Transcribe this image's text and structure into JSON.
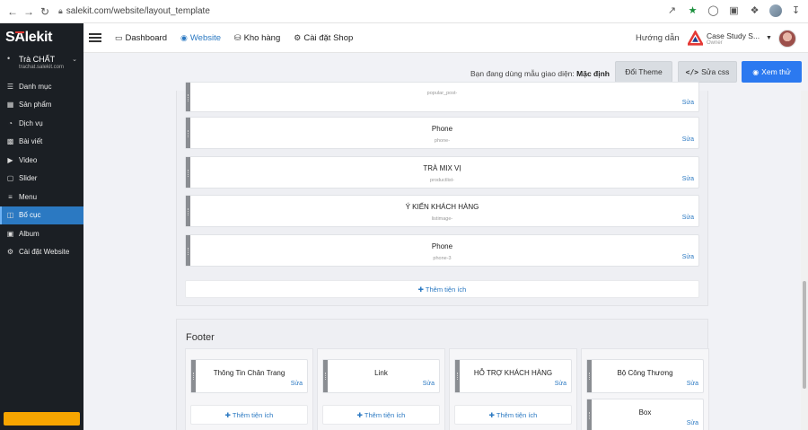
{
  "browser": {
    "url": "salekit.com/website/layout_template"
  },
  "sidebar": {
    "logo": "SAlekit",
    "logo_pre": "S",
    "logo_a": "A",
    "logo_post": "lekit",
    "store_name": "Trà CHẤT",
    "store_domain": "trachat.salekit.com",
    "items": [
      {
        "label": "Danh mục",
        "icon": "list-icon"
      },
      {
        "label": "Sản phẩm",
        "icon": "box-icon"
      },
      {
        "label": "Dịch vụ",
        "icon": "service-icon"
      },
      {
        "label": "Bài viết",
        "icon": "article-icon"
      },
      {
        "label": "Video",
        "icon": "video-icon"
      },
      {
        "label": "Slider",
        "icon": "slider-icon"
      },
      {
        "label": "Menu",
        "icon": "menu-icon"
      },
      {
        "label": "Bố cục",
        "icon": "layout-icon"
      },
      {
        "label": "Album",
        "icon": "album-icon"
      },
      {
        "label": "Cài đặt Website",
        "icon": "gear-icon"
      }
    ],
    "active_item": "Bố cục"
  },
  "topnav": {
    "items": [
      {
        "label": "Dashboard",
        "icon": "monitor-icon"
      },
      {
        "label": "Website",
        "icon": "globe-icon"
      },
      {
        "label": "Kho hàng",
        "icon": "database-icon"
      },
      {
        "label": "Cài đặt Shop",
        "icon": "gear-icon"
      }
    ],
    "active_item": "Website",
    "guide_label": "Hướng dẫn",
    "account_name": "Case Study S...",
    "account_role": "Owner"
  },
  "toolbar": {
    "template_prefix": "Bạn đang dùng mẫu giao diện:",
    "template_name": "Mặc định",
    "theme_button": "Đổi Theme",
    "css_button": "Sửa css",
    "preview_button": "Xem thử"
  },
  "widgets": [
    {
      "title": "",
      "code": "popular_post-",
      "edit": "Sửa"
    },
    {
      "title": "Phone",
      "code": "phone-",
      "edit": "Sửa"
    },
    {
      "title": "TRÀ MIX VỊ",
      "code": "productlist-",
      "edit": "Sửa"
    },
    {
      "title": "Ý KIẾN KHÁCH HÀNG",
      "code": "listimage-",
      "edit": "Sửa"
    },
    {
      "title": "Phone",
      "code": "phone-3",
      "edit": "Sửa"
    }
  ],
  "add_widget_label": "Thêm tiện ích",
  "footer": {
    "label": "Footer",
    "columns": [
      {
        "widgets": [
          {
            "title": "Thông Tin Chân Trang",
            "edit": "Sửa"
          }
        ],
        "add_label": "Thêm tiện ích"
      },
      {
        "widgets": [
          {
            "title": "Link",
            "edit": "Sửa"
          }
        ],
        "add_label": "Thêm tiện ích"
      },
      {
        "widgets": [
          {
            "title": "HỖ TRỢ KHÁCH HÀNG",
            "edit": "Sửa"
          }
        ],
        "add_label": "Thêm tiện ích"
      },
      {
        "widgets": [
          {
            "title": "Bộ Công Thương",
            "edit": "Sửa"
          },
          {
            "title": "Box",
            "edit": "Sửa"
          }
        ],
        "add_label": ""
      }
    ]
  },
  "colors": {
    "accent": "#2b79c2",
    "preview_button": "#2b79f0",
    "sidebar_bg": "#1b1f24",
    "promo": "#f7a500"
  }
}
